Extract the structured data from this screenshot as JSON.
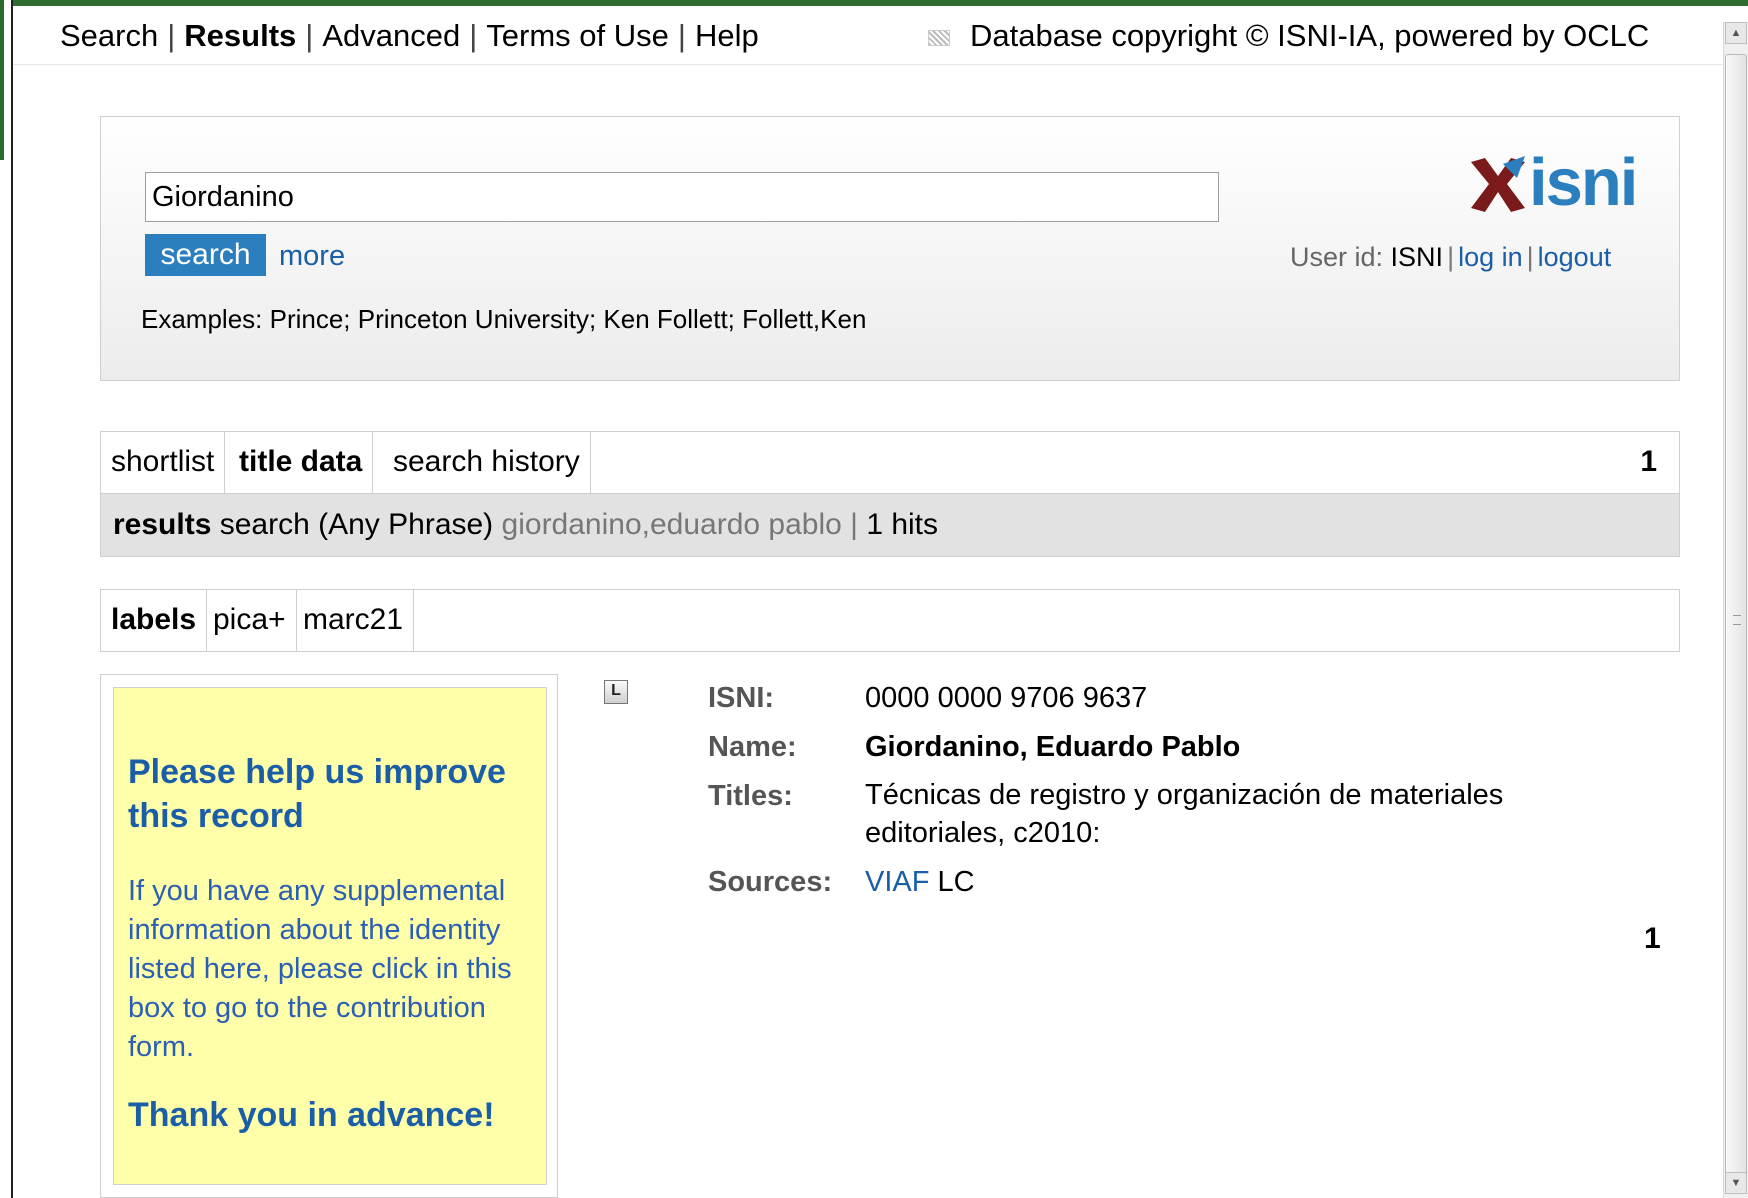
{
  "topnav": {
    "items": [
      "Search",
      "Results",
      "Advanced",
      "Terms of Use",
      "Help"
    ],
    "separator": "|",
    "copyright": "Database copyright © ISNI-IA, powered by OCLC"
  },
  "search": {
    "value": "Giordanino",
    "button_label": "search",
    "more_label": "more",
    "examples": "Examples: Prince; Princeton University; Ken Follett; Follett,Ken"
  },
  "logo": {
    "text": "isni"
  },
  "user": {
    "label": "User id:",
    "id": "ISNI",
    "separator": "|",
    "login": "log in",
    "logout": "logout"
  },
  "tabs": {
    "items": [
      "shortlist",
      "title data",
      "search history"
    ],
    "count": "1"
  },
  "results": {
    "label": "results",
    "query": "search (Any Phrase)",
    "term": "giordanino,eduardo pablo",
    "separator": "|",
    "hits": "1 hits"
  },
  "format_tabs": [
    "labels",
    "pica+",
    "marc21"
  ],
  "help_box": {
    "title": "Please help us improve this record",
    "text": "If you have any supplemental information about the identity listed here, please click in this box to go to the contribution form.",
    "thanks": "Thank you in advance!"
  },
  "record": {
    "icon": "record-icon",
    "isni_label": "ISNI:",
    "isni": "0000 0000 9706 9637",
    "name_label": "Name:",
    "name": "Giordanino, Eduardo Pablo",
    "titles_label": "Titles:",
    "titles": "Técnicas de registro y organización de materiales editoriales, c2010:",
    "sources_label": "Sources:",
    "sources": [
      "VIAF",
      "LC"
    ],
    "count": "1"
  },
  "colors": {
    "accent": "#2b7fbf",
    "link": "#1a5ea8",
    "help_bg": "#ffffaa",
    "results_bg": "#e2e2e2"
  }
}
